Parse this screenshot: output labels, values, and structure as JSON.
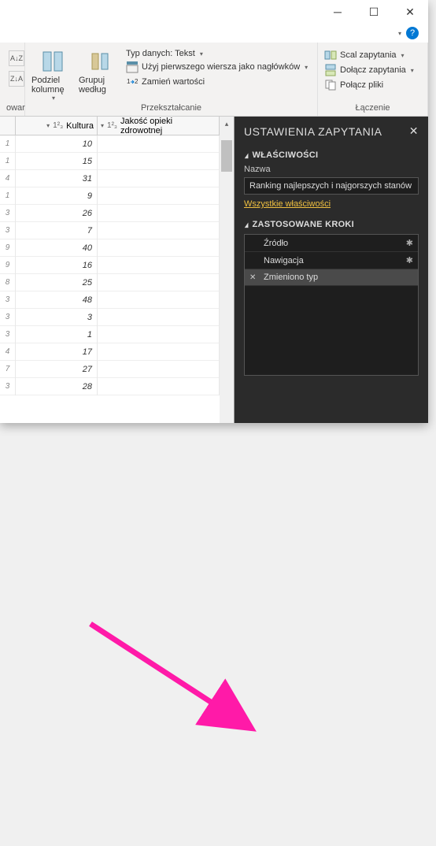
{
  "window": {
    "help_dropdown": "▾"
  },
  "ribbon": {
    "sort_asc": "A↓Z",
    "sort_desc": "Z↓A",
    "column_group_label": "owar",
    "split": {
      "label": "Podziel kolumnę"
    },
    "group": {
      "label": "Grupuj według"
    },
    "datatype": {
      "label": "Typ danych: Tekst"
    },
    "first_row": {
      "label": "Użyj pierwszego wiersza jako nagłówków"
    },
    "replace": {
      "label": "Zamień wartości"
    },
    "transform_group_label": "Przekształcanie",
    "merge": {
      "label": "Scal zapytania"
    },
    "append": {
      "label": "Dołącz zapytania"
    },
    "combine": {
      "label": "Połącz pliki"
    },
    "combine_group_label": "Łączenie"
  },
  "grid": {
    "col1": {
      "name": "Kultura",
      "type": "1²₃"
    },
    "col2": {
      "name": "Jakość opieki zdrowotnej",
      "type": "1²₃"
    },
    "row_nums": [
      "1",
      "1",
      "4",
      "1",
      "3",
      "3",
      "9",
      "9",
      "8",
      "3",
      "3",
      "3",
      "4",
      "7",
      "3"
    ],
    "col1_values": [
      "10",
      "15",
      "31",
      "9",
      "26",
      "7",
      "40",
      "16",
      "25",
      "48",
      "3",
      "1",
      "17",
      "27",
      "28"
    ],
    "col2_values": [
      "",
      "",
      "",
      "",
      "",
      "",
      "",
      "",
      "",
      "",
      "",
      "",
      "",
      "",
      ""
    ]
  },
  "settings": {
    "title": "USTAWIENIA ZAPYTANIA",
    "properties_title": "WŁAŚCIWOŚCI",
    "name_label": "Nazwa",
    "name_value": "Ranking najlepszych i najgorszych stanów",
    "all_props": "Wszystkie właściwości",
    "steps_title": "ZASTOSOWANE KROKI",
    "steps": [
      {
        "label": "Źródło",
        "gear": true
      },
      {
        "label": "Nawigacja",
        "gear": true
      },
      {
        "label": "Zmieniono typ",
        "gear": false,
        "selected": true,
        "deletable": true
      }
    ]
  }
}
